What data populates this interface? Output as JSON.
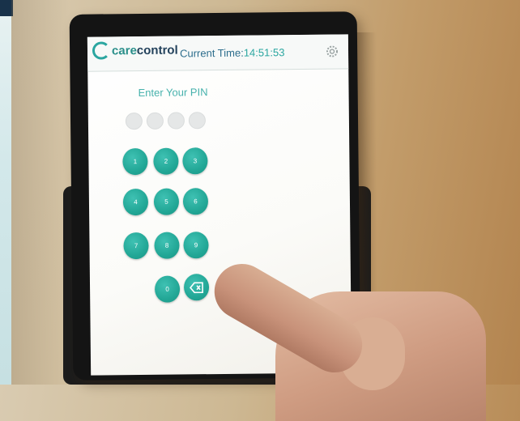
{
  "app": {
    "logo_care": "care",
    "logo_control": "control",
    "time_label": "Current Time:",
    "time_value": "14:51:53",
    "pin_prompt": "Enter Your PIN"
  },
  "pin_dots": 4,
  "keypad": {
    "keys": [
      "1",
      "2",
      "3",
      "4",
      "5",
      "6",
      "7",
      "8",
      "9",
      "0"
    ],
    "backspace_icon": "backspace-icon",
    "settings_icon": "gear-icon"
  },
  "colors": {
    "accent": "#22a796",
    "prompt": "#47b2ac",
    "brand_dark": "#23425c"
  }
}
